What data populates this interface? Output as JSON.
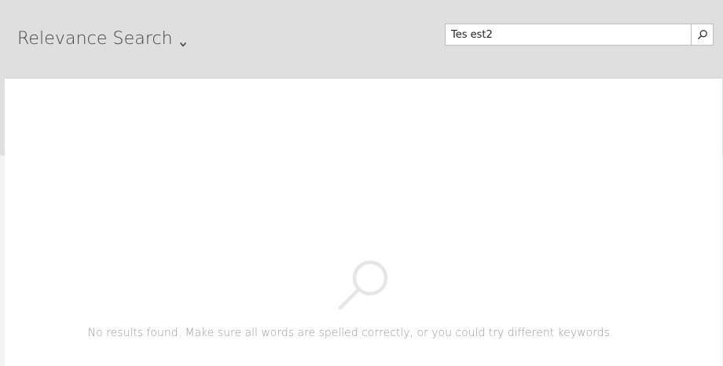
{
  "header": {
    "title": "Relevance Search",
    "title_dropdown_icon": "chevron-down-icon"
  },
  "search": {
    "value": "Tes est2",
    "placeholder": "",
    "button_icon": "search-icon"
  },
  "results": {
    "empty_icon": "magnifier-icon",
    "empty_message": "No results found. Make sure all words are spelled correctly, or you could try different keywords."
  },
  "colors": {
    "header_background": "#dfdfdf",
    "panel_background": "#ffffff",
    "title_text": "#444444",
    "muted_text": "#9a9a9a",
    "empty_icon": "#e6e6e6"
  }
}
